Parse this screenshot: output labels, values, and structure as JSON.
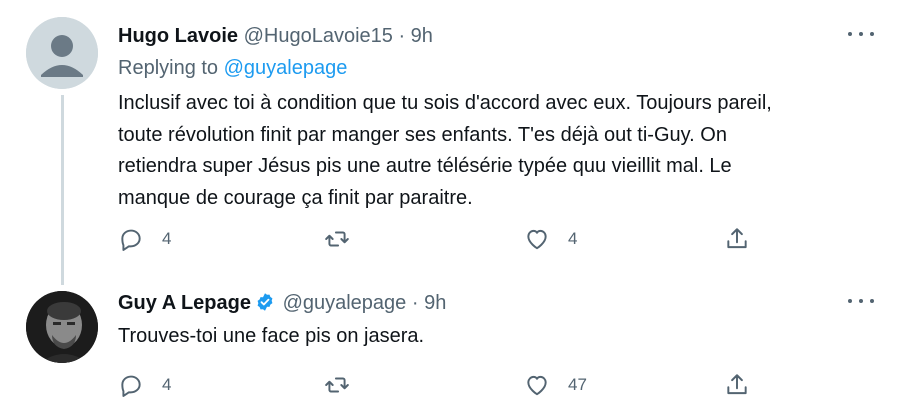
{
  "tweets": [
    {
      "name": "Hugo Lavoie",
      "handle": "@HugoLavoie15",
      "separator": "·",
      "time": "9h",
      "replying_prefix": "Replying to ",
      "replying_to": "@guyalepage",
      "text_lines": [
        "Inclusif avec toi à condition que tu sois d'accord avec eux. Toujours pareil,",
        "toute révolution finit par manger ses enfants. T'es déjà out ti-Guy. On",
        "retiendra super Jésus pis une autre télésérie typée quu vieillit mal. Le",
        "manque de courage ça finit par paraitre."
      ],
      "replies": "4",
      "retweets": "",
      "likes": "4"
    },
    {
      "name": "Guy A Lepage",
      "verified": true,
      "handle": "@guyalepage",
      "separator": "·",
      "time": "9h",
      "text": "Trouves-toi une face pis on jasera.",
      "replies": "4",
      "retweets": "",
      "likes": "47"
    }
  ],
  "colors": {
    "text": "#0f1419",
    "secondary": "#536471",
    "accent": "#1d9bf0",
    "thread_line": "#cfd9de"
  },
  "icons": [
    "more-icon",
    "reply-icon",
    "retweet-icon",
    "like-icon",
    "share-icon",
    "verified-badge-icon"
  ]
}
